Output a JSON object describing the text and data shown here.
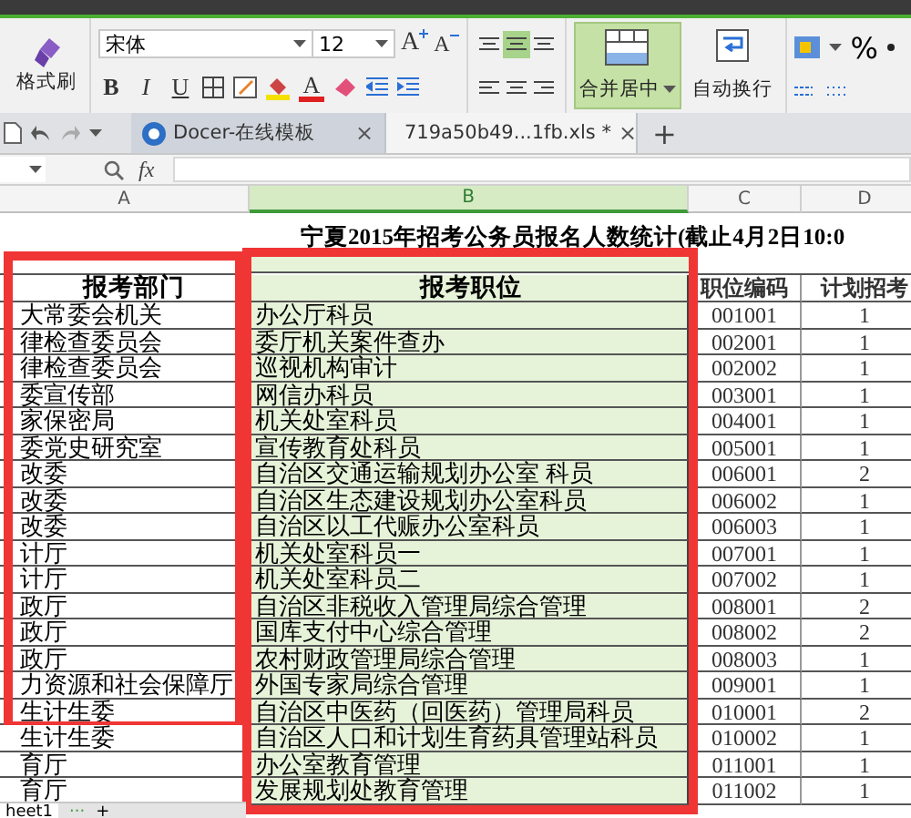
{
  "ribbon": {
    "format_painter": "格式刷",
    "font_name": "宋体",
    "font_size": "12",
    "font_size_buttons": [
      {
        "kind": "grow",
        "label": "A"
      },
      {
        "kind": "shrink",
        "label": "A"
      }
    ],
    "style_buttons": [
      {
        "kind": "bold",
        "label": "B"
      },
      {
        "kind": "italic",
        "label": "I"
      },
      {
        "kind": "underline",
        "label": "U"
      }
    ],
    "font_color_label": "A",
    "valign_buttons": [
      {
        "selected": false
      },
      {
        "selected": true
      },
      {
        "selected": false
      }
    ],
    "halign_buttons": [
      {
        "selected": false
      },
      {
        "selected": false
      },
      {
        "selected": false
      }
    ],
    "merge": {
      "label": "合并居中",
      "selected": true
    },
    "wrap": {
      "label": "自动换行",
      "selected": false
    },
    "percent": "%"
  },
  "tabs": [
    {
      "label": "Docer-在线模板",
      "kind": "docer",
      "selected": false,
      "close": "×"
    },
    {
      "label": "719a50b49...1fb.xls *",
      "kind": "sheet",
      "selected": true,
      "close": "×"
    }
  ],
  "new_tab": "+",
  "formula_bar": {
    "fx": "fx"
  },
  "sheet": {
    "columns": [
      {
        "label": "A",
        "selected": false
      },
      {
        "label": "B",
        "selected": true
      },
      {
        "label": "C",
        "selected": false
      },
      {
        "label": "D",
        "selected": false
      }
    ],
    "title": "宁夏2015年招考公务员报名人数统计(截止4月2日10:0",
    "headers": [
      "报考部门",
      "报考职位",
      "职位编码",
      "计划招考"
    ],
    "rows": [
      [
        "大常委会机关",
        "办公厅科员",
        "001001",
        "1"
      ],
      [
        "律检查委员会",
        "委厅机关案件查办",
        "002001",
        "1"
      ],
      [
        "律检查委员会",
        "巡视机构审计",
        "002002",
        "1"
      ],
      [
        "委宣传部",
        "网信办科员",
        "003001",
        "1"
      ],
      [
        "家保密局",
        "机关处室科员",
        "004001",
        "1"
      ],
      [
        "委党史研究室",
        "宣传教育处科员",
        "005001",
        "1"
      ],
      [
        "改委",
        "自治区交通运输规划办公室 科员",
        "006001",
        "2"
      ],
      [
        "改委",
        "自治区生态建设规划办公室科员",
        "006002",
        "1"
      ],
      [
        "改委",
        "自治区以工代赈办公室科员",
        "006003",
        "1"
      ],
      [
        "计厅",
        "机关处室科员一",
        "007001",
        "1"
      ],
      [
        "计厅",
        "机关处室科员二",
        "007002",
        "1"
      ],
      [
        "政厅",
        "自治区非税收入管理局综合管理",
        "008001",
        "2"
      ],
      [
        "政厅",
        "国库支付中心综合管理",
        "008002",
        "2"
      ],
      [
        "政厅",
        "农村财政管理局综合管理",
        "008003",
        "1"
      ],
      [
        "力资源和社会保障厅",
        "外国专家局综合管理",
        "009001",
        "1"
      ],
      [
        "生计生委",
        "自治区中医药（回医药）管理局科员",
        "010001",
        "2"
      ],
      [
        "生计生委",
        "自治区人口和计划生育药具管理站科员",
        "010002",
        "1"
      ],
      [
        "育厅",
        "办公室教育管理",
        "011001",
        "1"
      ],
      [
        "育厅",
        "发展规划处教育管理",
        "011002",
        "1"
      ]
    ]
  },
  "highlight_frames": [
    {
      "kind": "frame"
    },
    {
      "kind": "frame"
    }
  ],
  "sheet_tabs": {
    "tabs": [
      {
        "label": "heet1",
        "selected": true
      }
    ],
    "more": "···",
    "add": "+"
  }
}
